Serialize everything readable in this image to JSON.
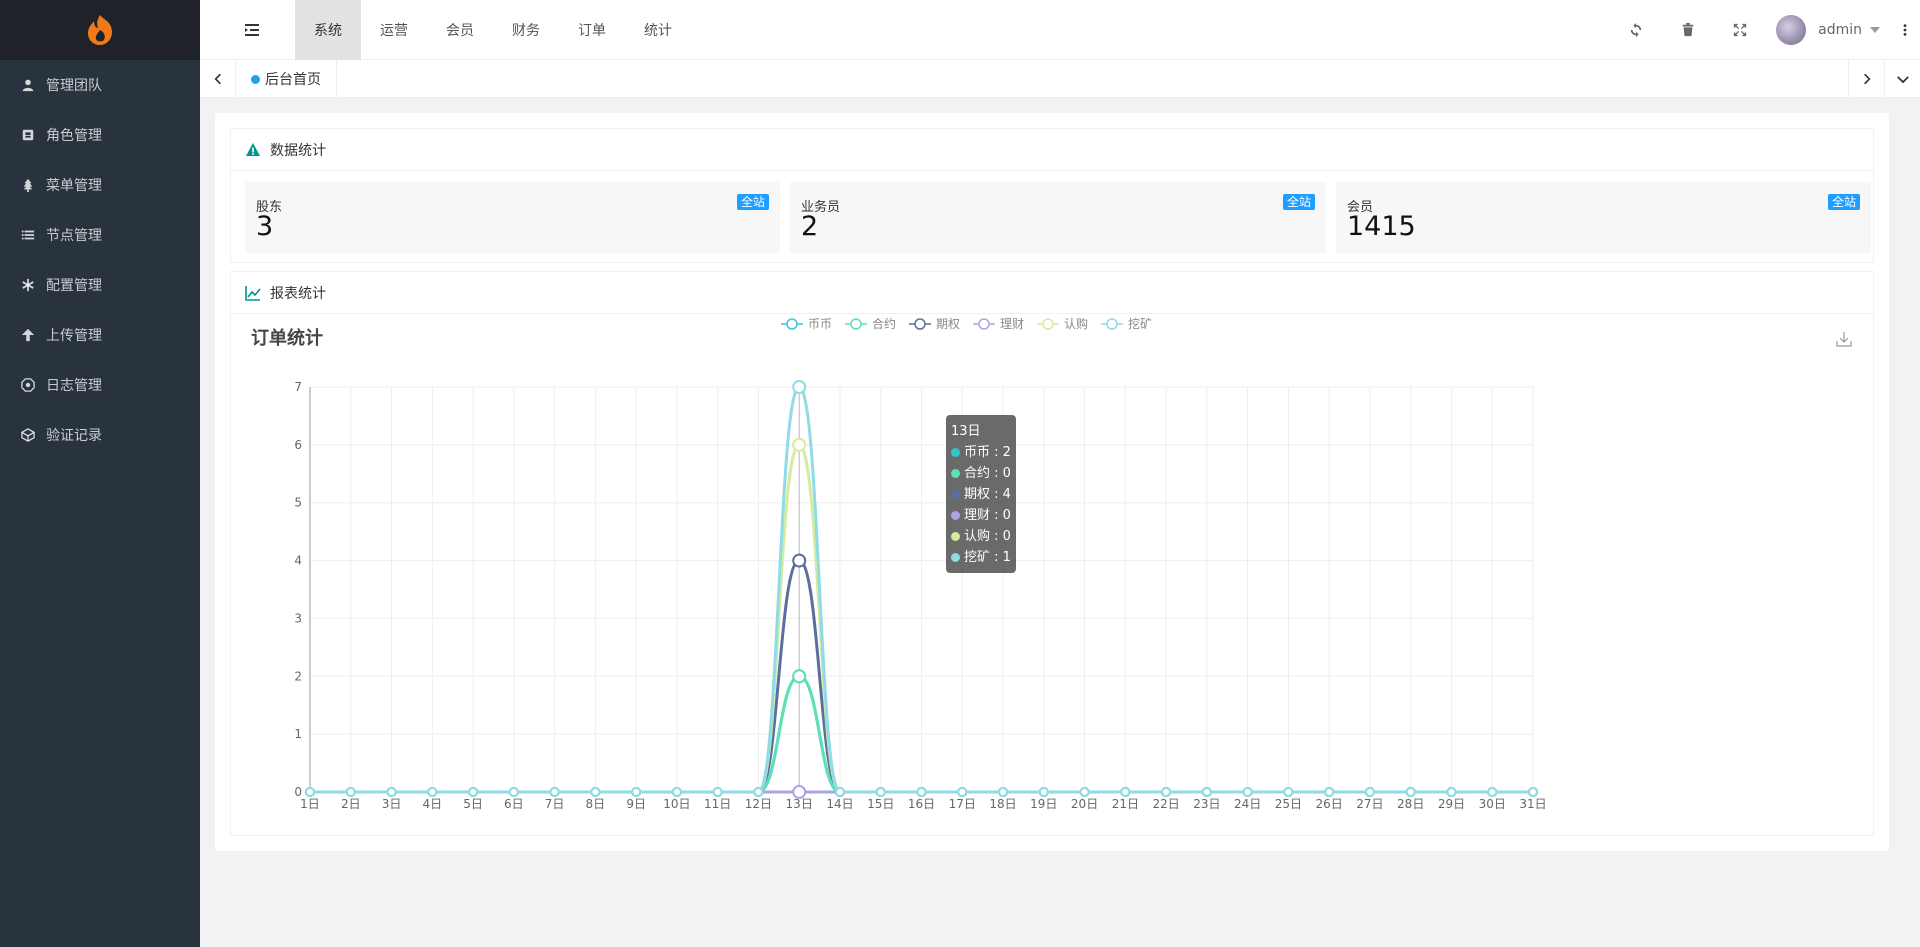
{
  "sidebar": {
    "items": [
      {
        "label": "管理团队",
        "icon": "user-icon"
      },
      {
        "label": "角色管理",
        "icon": "role-icon"
      },
      {
        "label": "菜单管理",
        "icon": "tree-icon"
      },
      {
        "label": "节点管理",
        "icon": "list-icon"
      },
      {
        "label": "配置管理",
        "icon": "asterisk-icon"
      },
      {
        "label": "上传管理",
        "icon": "upload-arrow-icon"
      },
      {
        "label": "日志管理",
        "icon": "log-icon"
      },
      {
        "label": "验证记录",
        "icon": "cube-icon"
      }
    ]
  },
  "header": {
    "tabs": [
      "系统",
      "运营",
      "会员",
      "财务",
      "订单",
      "统计"
    ],
    "active_tab": 0,
    "user_name": "admin"
  },
  "tabbar": {
    "current_tab": "后台首页"
  },
  "stats_panel": {
    "title": "数据统计",
    "cards": [
      {
        "title": "股东",
        "value": "3",
        "badge": "全站"
      },
      {
        "title": "业务员",
        "value": "2",
        "badge": "全站"
      },
      {
        "title": "会员",
        "value": "1415",
        "badge": "全站"
      }
    ]
  },
  "report_panel": {
    "title": "报表统计"
  },
  "tooltip": {
    "title": "13日",
    "rows": [
      {
        "label": "币币 : 2",
        "color": "#2ec7c9"
      },
      {
        "label": "合约 : 0",
        "color": "#5ce0b4"
      },
      {
        "label": "期权 : 4",
        "color": "#5a6fa0"
      },
      {
        "label": "理财 : 0",
        "color": "#a8a5e6"
      },
      {
        "label": "认购 : 0",
        "color": "#d4eba0"
      },
      {
        "label": "挖矿 : 1",
        "color": "#8fdbe6"
      }
    ]
  },
  "colors": {
    "sidebar_bg": "#28333e",
    "logo_bg": "#20222a",
    "accent": "#1e9fff",
    "active_tab_bg": "#e2e2e2"
  },
  "chart_data": {
    "type": "line",
    "title": "订单统计",
    "categories": [
      "1日",
      "2日",
      "3日",
      "4日",
      "5日",
      "6日",
      "7日",
      "8日",
      "9日",
      "10日",
      "11日",
      "12日",
      "13日",
      "14日",
      "15日",
      "16日",
      "17日",
      "18日",
      "19日",
      "20日",
      "21日",
      "22日",
      "23日",
      "24日",
      "25日",
      "26日",
      "27日",
      "28日",
      "29日",
      "30日",
      "31日"
    ],
    "ylim": [
      0,
      7
    ],
    "yticks": [
      0,
      1,
      2,
      3,
      4,
      5,
      6,
      7
    ],
    "grid": true,
    "legend_position": "top-center",
    "series": [
      {
        "name": "币币",
        "color": "#3ec3e6",
        "values": [
          0,
          0,
          0,
          0,
          0,
          0,
          0,
          0,
          0,
          0,
          0,
          0,
          2,
          0,
          0,
          0,
          0,
          0,
          0,
          0,
          0,
          0,
          0,
          0,
          0,
          0,
          0,
          0,
          0,
          0,
          0
        ]
      },
      {
        "name": "合约",
        "color": "#5ce0b4",
        "values": [
          0,
          0,
          0,
          0,
          0,
          0,
          0,
          0,
          0,
          0,
          0,
          0,
          2,
          0,
          0,
          0,
          0,
          0,
          0,
          0,
          0,
          0,
          0,
          0,
          0,
          0,
          0,
          0,
          0,
          0,
          0
        ]
      },
      {
        "name": "期权",
        "color": "#5a6fa0",
        "values": [
          0,
          0,
          0,
          0,
          0,
          0,
          0,
          0,
          0,
          0,
          0,
          0,
          4,
          0,
          0,
          0,
          0,
          0,
          0,
          0,
          0,
          0,
          0,
          0,
          0,
          0,
          0,
          0,
          0,
          0,
          0
        ]
      },
      {
        "name": "理财",
        "color": "#a8a5e6",
        "values": [
          0,
          0,
          0,
          0,
          0,
          0,
          0,
          0,
          0,
          0,
          0,
          0,
          0,
          0,
          0,
          0,
          0,
          0,
          0,
          0,
          0,
          0,
          0,
          0,
          0,
          0,
          0,
          0,
          0,
          0,
          0
        ]
      },
      {
        "name": "认购",
        "color": "#d4eba0",
        "values": [
          0,
          0,
          0,
          0,
          0,
          0,
          0,
          0,
          0,
          0,
          0,
          0,
          6,
          0,
          0,
          0,
          0,
          0,
          0,
          0,
          0,
          0,
          0,
          0,
          0,
          0,
          0,
          0,
          0,
          0,
          0
        ]
      },
      {
        "name": "挖矿",
        "color": "#8fdbe6",
        "values": [
          0,
          0,
          0,
          0,
          0,
          0,
          0,
          0,
          0,
          0,
          0,
          0,
          7,
          0,
          0,
          0,
          0,
          0,
          0,
          0,
          0,
          0,
          0,
          0,
          0,
          0,
          0,
          0,
          0,
          0,
          0
        ]
      }
    ]
  }
}
